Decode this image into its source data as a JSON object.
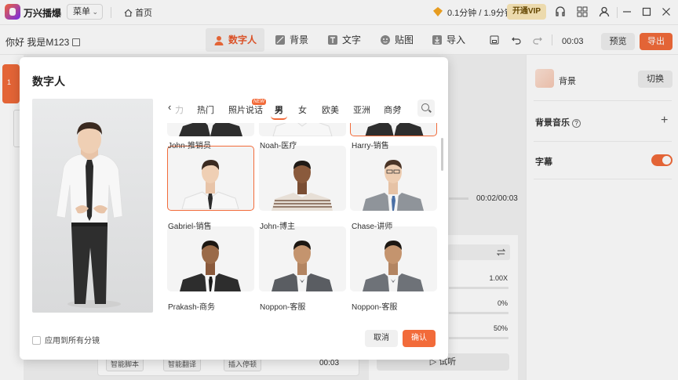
{
  "app": {
    "title": "万兴播爆"
  },
  "topbar": {
    "menu_label": "菜单",
    "home_label": "首页",
    "price_text": "0.1分钟 / 1.9分钟",
    "vip_label": "开通VIP"
  },
  "toolbar": {
    "project_name": "你好 我是M123",
    "tabs": [
      {
        "label": "数字人",
        "active": true
      },
      {
        "label": "背景"
      },
      {
        "label": "文字"
      },
      {
        "label": "贴图"
      },
      {
        "label": "导入"
      }
    ],
    "time": "00:03",
    "preview_label": "预览",
    "export_label": "导出"
  },
  "scenes": {
    "first_index": "1"
  },
  "player": {
    "time": "00:02/00:03"
  },
  "settings": {
    "speed": "1.00X",
    "pitch": "0%",
    "volume": "50%",
    "listen_label": "试听"
  },
  "script_bar": {
    "btn1": "智能脚本",
    "btn2": "智能翻译",
    "btn3": "插入停顿",
    "time": "00:03"
  },
  "right_panel": {
    "background_label": "背景",
    "switch_label": "切换",
    "bg_music_label": "背景音乐",
    "subtitle_label": "字幕"
  },
  "modal": {
    "title": "数字人",
    "categories": [
      "热门",
      "照片说话",
      "男",
      "女",
      "欧美",
      "亚洲",
      "商务"
    ],
    "active_category": "男",
    "new_badge": "NEW",
    "top_row_labels": [
      "John-推销员",
      "Noah-医疗",
      "Harry-销售"
    ],
    "rows": [
      [
        "Gabriel-销售",
        "John-博主",
        "Chase-讲师"
      ],
      [
        "Prakash-商务",
        "Noppon-客服",
        "Noppon-客服"
      ]
    ],
    "selected": "Gabriel-销售",
    "apply_all_label": "应用到所有分镜",
    "cancel_label": "取消",
    "confirm_label": "确认"
  },
  "colors": {
    "accent": "#f26b3a",
    "vip_bg": "#fbe8b8"
  }
}
